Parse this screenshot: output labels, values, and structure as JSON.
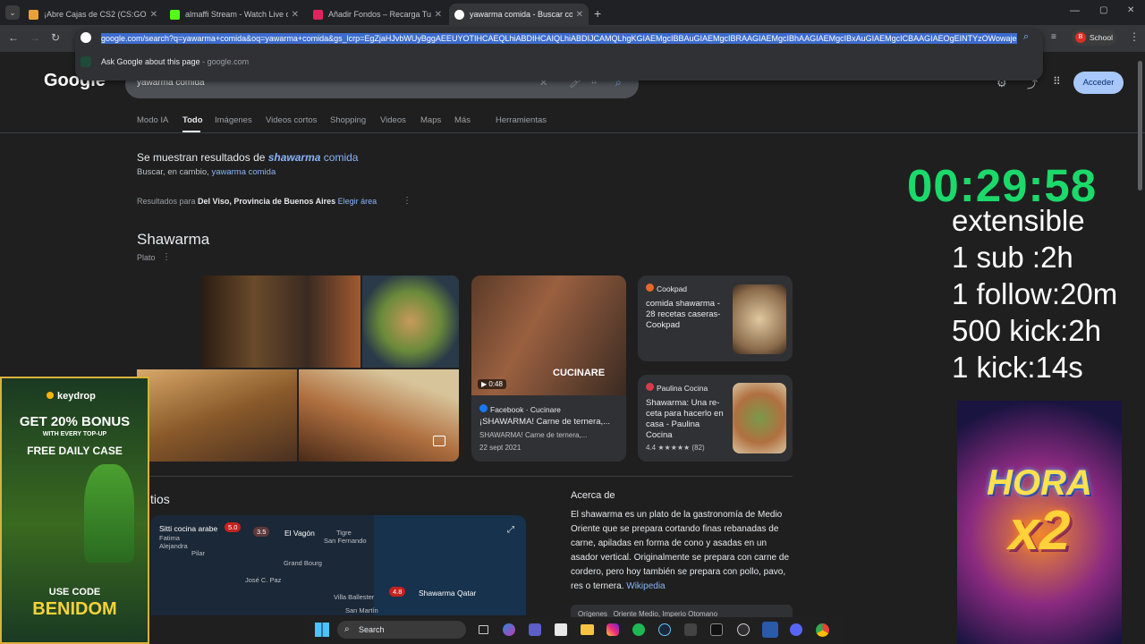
{
  "tabs": [
    {
      "title": "¡Abre Cajas de CS2 (CS:GO), Ga",
      "color": "#e9a23b"
    },
    {
      "title": "almaffi Stream - Watch Live on",
      "color": "#53fc18"
    },
    {
      "title": "Añadir Fondos – Recarga Tu Sa",
      "color": "#e0245e"
    },
    {
      "title": "yawarma comida - Buscar con G",
      "color": "#4285f4"
    }
  ],
  "profile": {
    "label": "School",
    "initial": "B"
  },
  "omnibox": {
    "url": "google.com/search?q=yawarma+comida&oq=yawarma+comida&gs_lcrp=EgZjaHJvbWUyBggAEEUYOTIHCAEQLhiABDIHCAIQLhiABDIJCAMQLhgKGIAEMgcIBBAuGIAEMgcIBRAAGIAEMgcIBhAAGIAEMgcIBxAuGIAEMgcICBAAGIAEOgEINTYzOWowajeoA",
    "suggestion": "Ask Google about this page",
    "suggestion_site": "google.com"
  },
  "google": {
    "logo": "Google",
    "query": "yawarma comida",
    "login": "Acceder",
    "nav": [
      "Modo IA",
      "Todo",
      "Imágenes",
      "Videos cortos",
      "Shopping",
      "Videos",
      "Maps",
      "Más",
      "Herramientas"
    ],
    "showing_prefix": "Se muestran resultados de ",
    "showing_bold": "shawarma",
    "showing_rest": " comida",
    "instead_prefix": "Buscar, en cambio, ",
    "instead_link": "yawarma comida",
    "results_for": "Resultados para ",
    "location": "Del Viso, Provincia de Buenos Aires",
    "choose_area": "Elegir área",
    "entity_title": "Shawarma",
    "entity_sub": "Plato",
    "video": {
      "duration": "0:48",
      "brand": "CUCINARE",
      "source": "Facebook · Cucinare",
      "title": "¡SHAWARMA! Carne de ternera,...",
      "sub": "SHAWARMA! Carne de ternera,...",
      "date": "22 sept 2021"
    },
    "recipes": [
      {
        "source": "Cookpad",
        "title": "comida shawarma - 28 recetas caseras- Cookpad",
        "color": "#e8672b"
      },
      {
        "source": "Paulina Cocina",
        "title": "Shawarma: Una re-ceta para hacerlo en casa - Paulina Cocina",
        "rating": "4.4 ★★★★★ (82)",
        "color": "#d93b4a"
      }
    ],
    "map_title": "tios",
    "map_labels": [
      {
        "t": "Sitti cocina arabe",
        "r": "5.0"
      },
      {
        "t": "Fatima",
        "r": ""
      },
      {
        "t": "Alejandra",
        "r": ""
      },
      {
        "t": "3.5",
        "r": ""
      },
      {
        "t": "El Vagón",
        "r": ""
      },
      {
        "t": "Tigre",
        "r": ""
      },
      {
        "t": "San Fernando",
        "r": ""
      },
      {
        "t": "Pilar",
        "r": ""
      },
      {
        "t": "Grand Bourg",
        "r": ""
      },
      {
        "t": "José C. Paz",
        "r": ""
      },
      {
        "t": "Villa Ballester",
        "r": ""
      },
      {
        "t": "Shawarma Qatar",
        "r": "4.8"
      },
      {
        "t": "San Martín",
        "r": ""
      }
    ],
    "about_title": "Acerca de",
    "about_text": "El shawarma es un plato de la gastronomía de Medio Oriente que se prepara cortando finas rebanadas de carne, apiladas en forma de cono y asadas en un asador vertical. Originalmente se prepara con carne de cordero, pero hoy también se prepara con pollo, pavo, res o ternera.",
    "about_link": "Wikipedia",
    "about_row": "Orígenes   Oriente Medio, Imperio Otomano"
  },
  "overlay": {
    "timer": "00:29:58",
    "lines": [
      "extensible",
      "1 sub :2h",
      "1 follow:20m",
      "500 kick:2h",
      "1 kick:14s"
    ],
    "ad": {
      "brand": "keydrop",
      "bonus": "GET 20% BONUS",
      "top": "WITH EVERY TOP-UP",
      "daily": "FREE DAILY CASE",
      "use": "USE CODE",
      "code": "BENIDOM"
    },
    "hora": {
      "line1": "HORA",
      "line2": "x2"
    }
  },
  "taskbar": {
    "search": "Search"
  }
}
